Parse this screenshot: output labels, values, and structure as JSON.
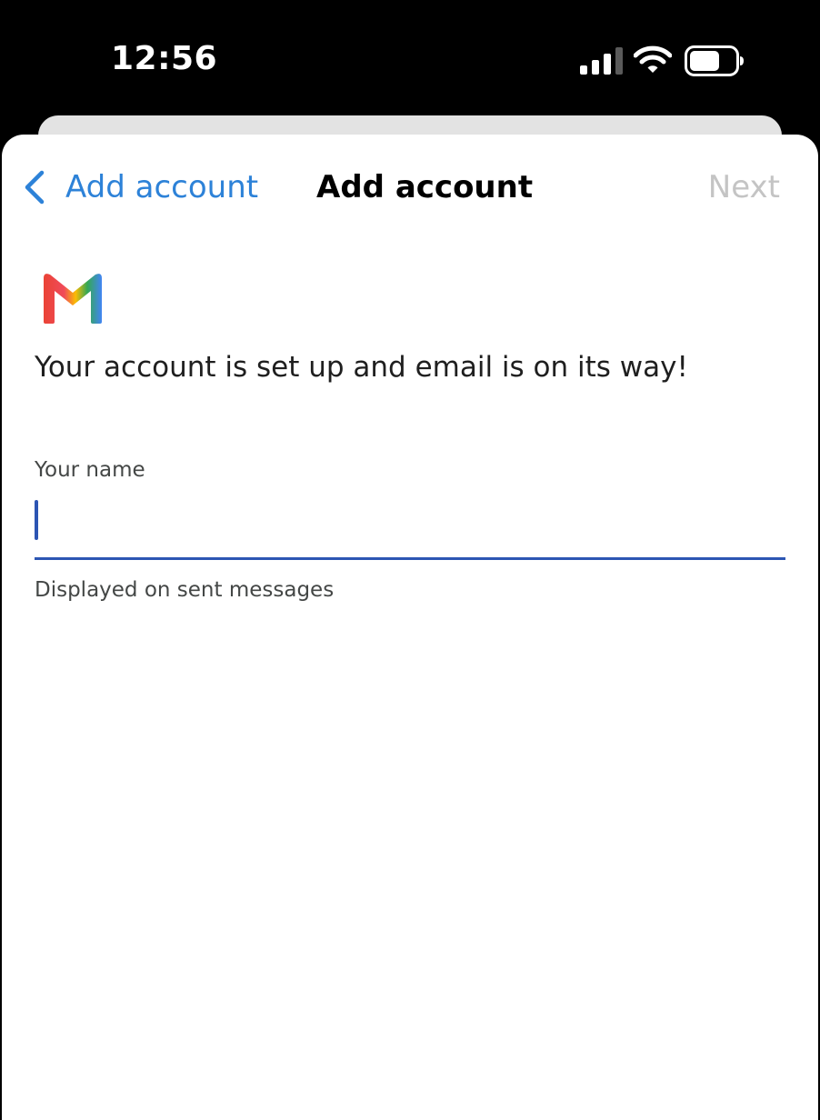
{
  "status_bar": {
    "time": "12:56",
    "icons": [
      "signal-icon",
      "wifi-icon",
      "battery-icon"
    ]
  },
  "nav": {
    "back_label": "Add account",
    "title": "Add account",
    "next_label": "Next"
  },
  "content": {
    "logo": "gmail-logo",
    "headline": "Your account is set up and email is on its way!",
    "name_field": {
      "label": "Your name",
      "value": "",
      "helper": "Displayed on sent messages"
    }
  },
  "colors": {
    "accent_blue": "#2d82d8",
    "field_underline": "#2c55b3",
    "next_disabled": "#c4c4c4"
  }
}
